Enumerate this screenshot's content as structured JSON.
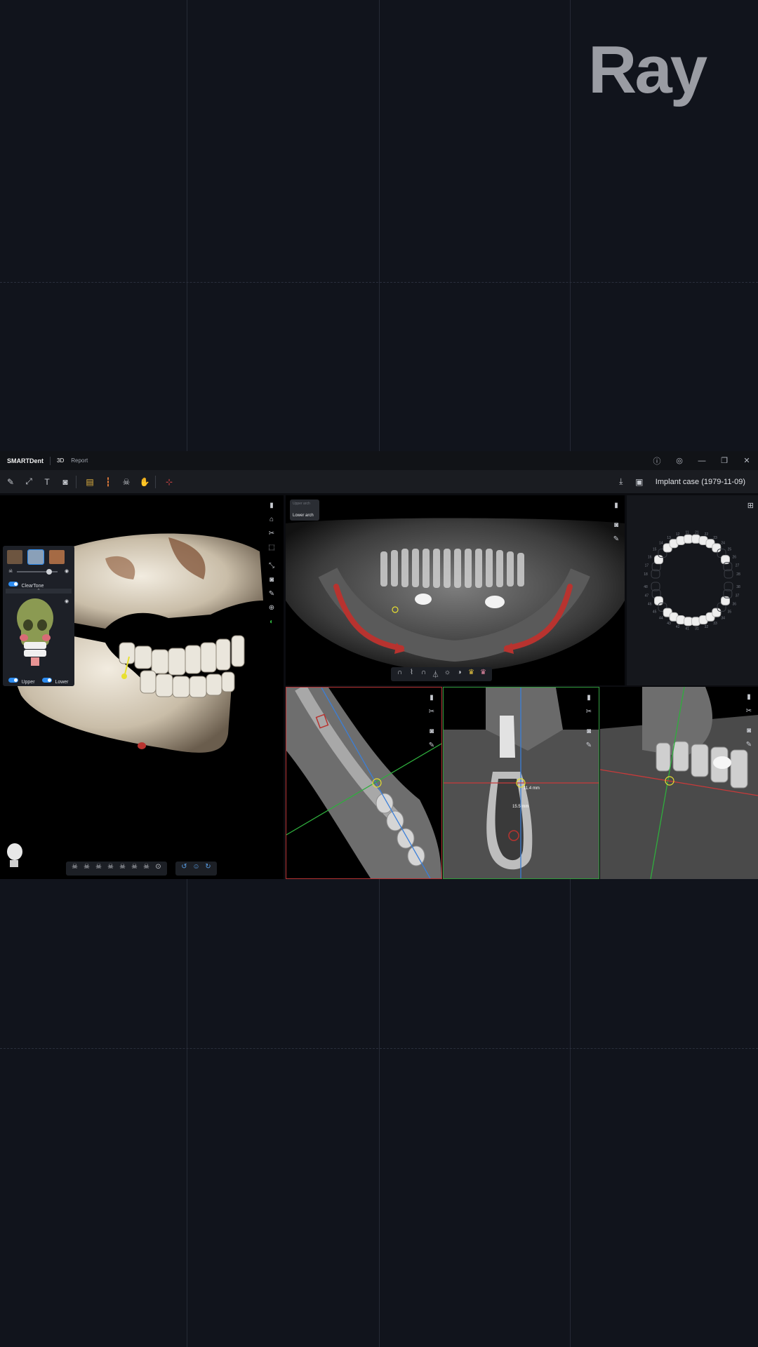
{
  "brand_logo": "Ray",
  "app": {
    "title": "SMARTDent",
    "tabs": [
      {
        "label": "3D",
        "active": true
      },
      {
        "label": "Report",
        "active": false
      }
    ],
    "window_controls": [
      "info-icon",
      "settings-icon",
      "minimize-icon",
      "restore-icon",
      "close-icon"
    ]
  },
  "toolbar": {
    "case_title": "Implant case (1979-11-09)",
    "left_tools": [
      "draw-icon",
      "measure-icon",
      "text-icon",
      "camera-icon",
      "layers-icon",
      "color-icon",
      "skull-icon",
      "hand-icon",
      "axis-icon"
    ],
    "right_tools": [
      "download-icon",
      "save-icon"
    ]
  },
  "view3d": {
    "cleartone_label": "ClearTone",
    "upper_label": "Upper",
    "lower_label": "Lower",
    "upper_on": true,
    "lower_on": true
  },
  "panorama": {
    "arch_option_upper": "Upper arch",
    "arch_option_lower": "Lower arch"
  },
  "tooth_chart": {
    "upper_numbers": [
      "18",
      "17",
      "16",
      "15",
      "14",
      "13",
      "12",
      "11",
      "21",
      "22",
      "23",
      "24",
      "25",
      "26",
      "27",
      "28"
    ],
    "lower_numbers": [
      "48",
      "47",
      "46",
      "45",
      "44",
      "43",
      "42",
      "41",
      "31",
      "32",
      "33",
      "34",
      "35",
      "36",
      "37",
      "38"
    ]
  },
  "cross_section": {
    "measure_1": "11.4 mm",
    "measure_2": "15.5 mm"
  },
  "colors": {
    "accent": "#2d8cf0",
    "axis_red": "#c83a3a",
    "axis_green": "#2fae3d",
    "axis_blue": "#3b7fd8",
    "implant_yellow": "#e8e030",
    "nerve_red": "#b8332f"
  }
}
